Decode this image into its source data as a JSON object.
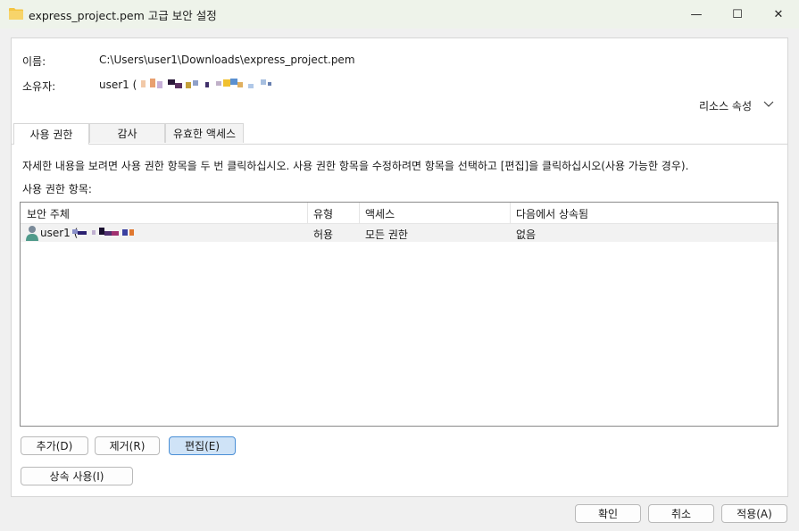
{
  "window": {
    "title": "express_project.pem 고급 보안 설정",
    "minimize_glyph": "—",
    "maximize_glyph": "☐",
    "close_glyph": "✕"
  },
  "info": {
    "name_label": "이름:",
    "name_value": "C:\\Users\\user1\\Downloads\\express_project.pem",
    "owner_label": "소유자:",
    "owner_value": "user1 ("
  },
  "resource_properties_label": "리소스 속성",
  "tabs": [
    {
      "label": "사용 권한"
    },
    {
      "label": "감사"
    },
    {
      "label": "유효한 액세스"
    }
  ],
  "description": "자세한 내용을 보려면 사용 권한 항목을 두 번 클릭하십시오. 사용 권한 항목을 수정하려면 항목을 선택하고 [편집]을 클릭하십시오(사용 가능한 경우).",
  "entries_label": "사용 권한 항목:",
  "table": {
    "columns": [
      "보안 주체",
      "유형",
      "액세스",
      "다음에서 상속됨"
    ],
    "rows": [
      {
        "principal": "user1 (",
        "type": "허용",
        "access": "모든 권한",
        "inherited_from": "없음"
      }
    ]
  },
  "buttons": {
    "add": "추가(D)",
    "remove": "제거(R)",
    "edit": "편집(E)",
    "inheritance": "상속 사용(I)"
  },
  "footer": {
    "ok": "확인",
    "cancel": "취소",
    "apply": "적용(A)"
  },
  "colors": {
    "accent": "#4a8fd6",
    "folder": "#f4c542"
  }
}
